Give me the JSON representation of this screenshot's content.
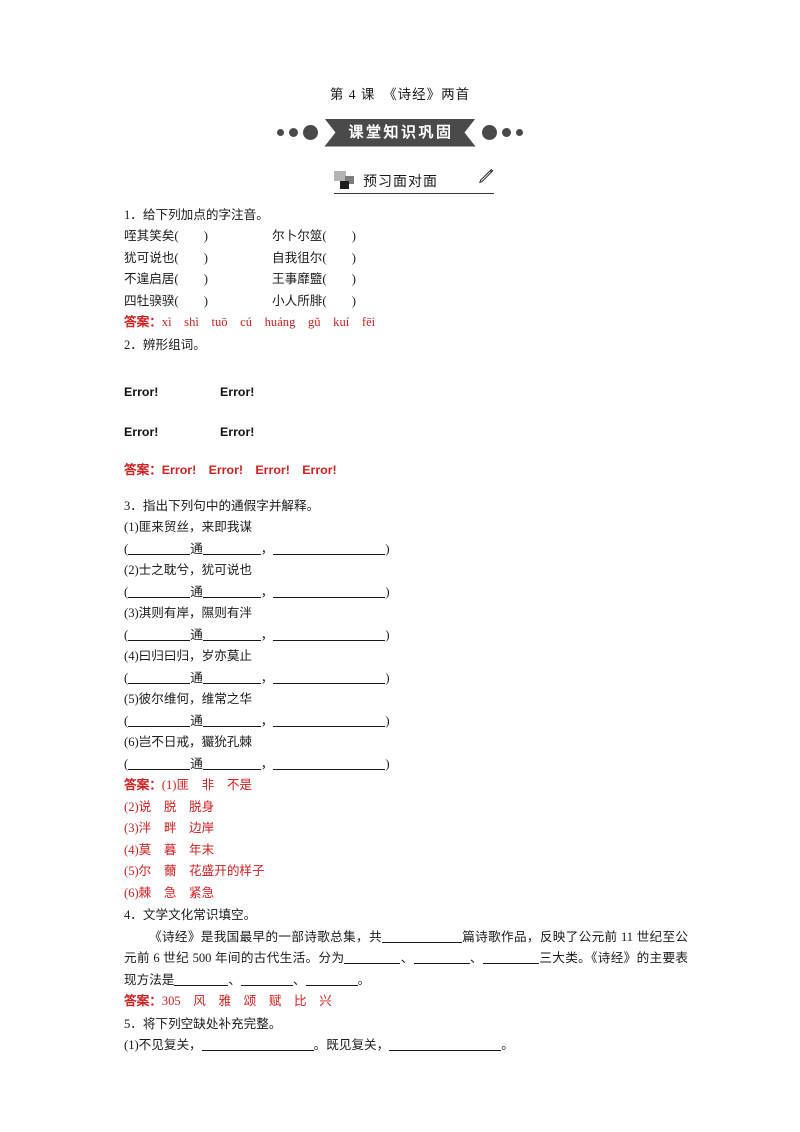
{
  "document": {
    "chapter_title": "第 4 课　《诗经》两首",
    "banner_label": "课堂知识巩固",
    "section_heading": "预习面对面",
    "answer_label": "答案：",
    "accent_color": "#d32020",
    "banner_color": "#4a4a4a"
  },
  "q1": {
    "title": "1．给下列加点的字注音。",
    "items": [
      {
        "left": "咥其笑矣(　　)",
        "right": "尔卜尔筮(　　)"
      },
      {
        "left": "犹可说也(　　)",
        "right": "自我徂尔(　　)"
      },
      {
        "left": "不遑启居(　　)",
        "right": "王事靡盬(　　)"
      },
      {
        "left": "四牡骙骙(　　)",
        "right": "小人所腓(　　)"
      }
    ],
    "answer": "xì　shì　tuō　cú　huáng　gǔ　kuí　fēi"
  },
  "q2": {
    "title": "2．辨形组词。",
    "cells": [
      [
        "Error!",
        "Error!"
      ],
      [
        "Error!",
        "Error!"
      ]
    ],
    "answer": "Error!　Error!　Error!　Error!"
  },
  "q3": {
    "title": "3．指出下列句中的通假字并解释。",
    "items": [
      "(1)匪来贸丝，来即我谋",
      "(2)士之耽兮，犹可说也",
      "(3)淇则有岸，隰则有泮",
      "(4)曰归曰归，岁亦莫止",
      "(5)彼尔维何，维常之华",
      "(6)岂不日戒，玁狁孔棘"
    ],
    "blank_word": "通",
    "answers": [
      "(1)匪　非　不是",
      "(2)说　脱　脱身",
      "(3)泮　畔　边岸",
      "(4)莫　暮　年末",
      "(5)尔　薾　花盛开的样子",
      "(6)棘　急　紧急"
    ]
  },
  "q4": {
    "title": "4．文学文化常识填空。",
    "text_1": "《诗经》是我国最早的一部诗歌总集，共",
    "text_2": "篇诗歌作品，反映了公元前 11 世纪至公元前 6 世纪 500 年间的古代生活。分为",
    "text_3": "、",
    "text_4": "、",
    "text_5": "三大类。《诗经》的主要表现方法是",
    "text_6": "、",
    "text_7": "、",
    "text_8": "。",
    "answer": "305　风　雅　颂　赋　比　兴"
  },
  "q5": {
    "title": "5．将下列空缺处补充完整。",
    "item_1a": "(1)不见复关，",
    "item_1b": "。既见复关，",
    "item_1c": "。"
  }
}
